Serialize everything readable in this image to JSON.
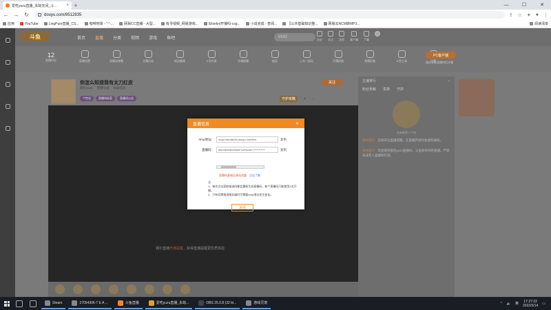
{
  "browser": {
    "tab_title": "爱吃yuzu直播_永劫无间_斗...",
    "address": "douyu.com/8512835",
    "bookmarks": [
      "应用",
      "YouTube",
      "LingPure直播_CS...",
      "咖啡地球 - \"-\"-...",
      "网易CC直播 - 大型...",
      "有寻视频_网易游戏...",
      "Elisekni开播吗-csg...",
      "小说完成 - 查阅...",
      "【公共基础知识整...",
      "网易云NCM转MP3..."
    ],
    "reading_list": "阅读清单"
  },
  "site": {
    "logo": "斗鱼",
    "nav": [
      "首页",
      "直播",
      "分类",
      "视频",
      "游戏",
      "鱼吧"
    ],
    "search_placeholder": "IH262",
    "top_icons": [
      "历史",
      "关注",
      "消息",
      "客户端",
      "下载"
    ],
    "stats": {
      "value": "12",
      "label": "直播时长"
    },
    "tools": [
      "直播设置",
      "直播间弹幕",
      "主播任务",
      "粉丝徽章",
      "K币兑换",
      "开播提醒",
      "抽奖",
      "上车一起玩",
      "开播权限",
      "直播回看",
      "斗鱼工具",
      "设置"
    ],
    "pc_button": "PC客户端",
    "pc_sub": "通过斗鱼直播伴侣开播"
  },
  "room": {
    "title": "你怎么知道我有太刀红皮",
    "meta": [
      "爱吃yuzu",
      "直播分类",
      "永劫无间"
    ],
    "tags": [
      "个性化",
      "直播间标签",
      "直播间公告"
    ],
    "follow": "关注",
    "guard": "守护攻略",
    "offline_prefix": "偶尔直播",
    "offline_link": "开播提醒",
    "offline_suffix": "，获得直播提醒更优质体验"
  },
  "chat": {
    "header": "主播排行",
    "tabs": [
      "粉丝贡献",
      "贵族",
      "守护"
    ],
    "caption": "快来做第一个吧",
    "notice_label": "系统提示：",
    "notice1": "已经开启直播提醒，在直播开始时会收到通知。",
    "notice2": "欢迎来到爱吃yuzu直播间，斗鱼倡导绿色直播，严禁未成年人直播和打赏。"
  },
  "modal": {
    "title": "直播信息",
    "rtmp_label": "rtmp地址：",
    "rtmp_value": "rtmp://sendtc3a.douyu.com/live",
    "key_label": "直播码：",
    "key_value": "8512835rtDoNkhFxoSecret=***********",
    "copy": "复制",
    "warning": "直播码复制后请勿泄露",
    "learn_more": "点击了解",
    "notes_title": "注:",
    "note1": "1、每次点击获取推流码都会重新生成直播码，每个直播码只能使用1次开播。",
    "note2": "2、只有切换推流服务器时才需要rtmp地址发生变化。",
    "ok": "关闭"
  },
  "taskbar": {
    "apps": [
      "Steam",
      "27054306-T E A ...",
      "斗鱼直播",
      "爱吃yuzu直播_永劫...",
      "OBS 25.0.8 (32 bi...",
      "游戏灵境"
    ],
    "time": "17:27:22",
    "date": "2022/3/14",
    "lang": "英"
  },
  "colors": {
    "accent": "#f08a22",
    "overlay": "#7a7a7a"
  }
}
